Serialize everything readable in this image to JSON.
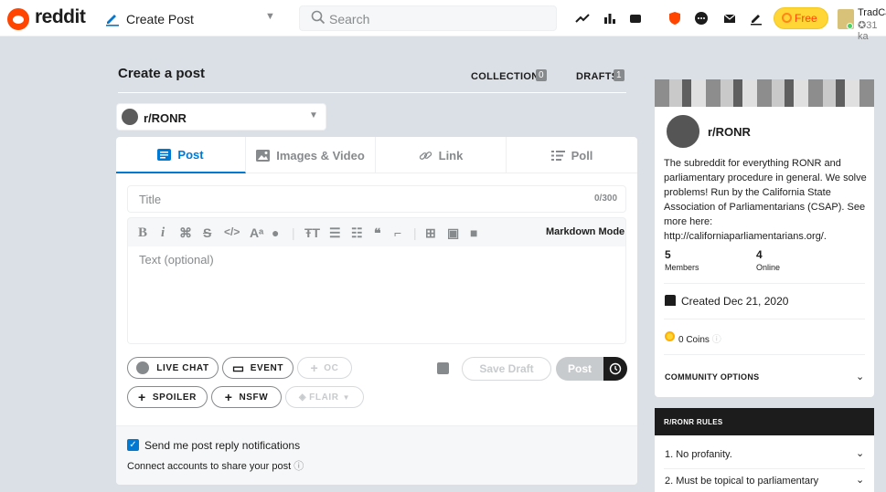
{
  "header": {
    "wordmark": "reddit",
    "page_title": "Create Post",
    "search_placeholder": "Search",
    "free_label": "Free",
    "username": "TradCat",
    "karma": "31 ka"
  },
  "create": {
    "title": "Create a post",
    "collections_label": "COLLECTIONS",
    "collections_count": "0",
    "drafts_label": "DRAFTS",
    "drafts_count": "1",
    "community": "r/RONR"
  },
  "tabs": [
    {
      "label": "Post",
      "icon": "post-icon"
    },
    {
      "label": "Images & Video",
      "icon": "image-icon"
    },
    {
      "label": "Link",
      "icon": "link-icon"
    },
    {
      "label": "Poll",
      "icon": "poll-icon"
    }
  ],
  "editor": {
    "title_placeholder": "Title",
    "title_count": "0/300",
    "markdown_mode": "Markdown Mode",
    "text_placeholder": "Text (optional)"
  },
  "actions": {
    "live_chat": "LIVE CHAT",
    "event": "EVENT",
    "oc": "OC",
    "spoiler": "SPOILER",
    "nsfw": "NSFW",
    "flair": "FLAIR",
    "save_draft": "Save Draft",
    "post": "Post"
  },
  "footer": {
    "notifications": "Send me post reply notifications",
    "connect": "Connect accounts to share your post"
  },
  "sidebar": {
    "name": "r/RONR",
    "description": "The subreddit for everything RONR and parliamentary procedure in general. We solve problems! Run by the California State Association of Parliamentarians (CSAP). See more here: http://californiaparliamentarians.org/.",
    "members_count": "5",
    "members_label": "Members",
    "online_count": "4",
    "online_label": "Online",
    "created": "Created Dec 21, 2020",
    "coins": "0 Coins",
    "community_options": "COMMUNITY OPTIONS"
  },
  "rules": {
    "title": "R/RONR RULES",
    "items": [
      "1. No profanity.",
      "2. Must be topical to parliamentary"
    ]
  },
  "colors": {
    "brand": "#ff4500",
    "accent": "#0079d3",
    "premium": "#ffd635"
  }
}
